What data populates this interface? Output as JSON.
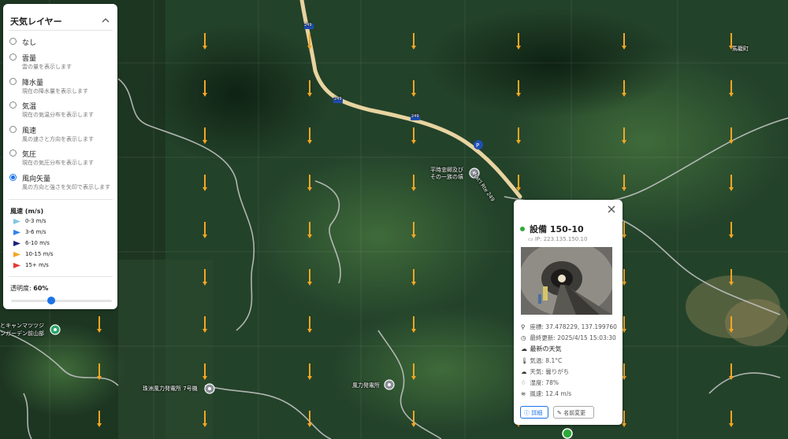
{
  "weather_panel": {
    "title": "天気レイヤー",
    "layers": [
      {
        "name": "なし",
        "desc": "",
        "checked": false
      },
      {
        "name": "雲量",
        "desc": "雲の量を表示します",
        "checked": false
      },
      {
        "name": "降水量",
        "desc": "現在の降水量を表示します",
        "checked": false
      },
      {
        "name": "気温",
        "desc": "現在の気温分布を表示します",
        "checked": false
      },
      {
        "name": "風速",
        "desc": "風の速さと方向を表示します",
        "checked": false
      },
      {
        "name": "気圧",
        "desc": "現在の気圧分布を表示します",
        "checked": false
      },
      {
        "name": "風向矢量",
        "desc": "風の方向と強さを矢印で表示します",
        "checked": true
      }
    ],
    "legend_title": "風速 (m/s)",
    "legend": [
      {
        "label": "0-3 m/s",
        "color": "#7ec8e3"
      },
      {
        "label": "3-6 m/s",
        "color": "#2f80ed"
      },
      {
        "label": "6-10 m/s",
        "color": "#1a237e"
      },
      {
        "label": "10-15 m/s",
        "color": "#f5a623"
      },
      {
        "label": "15+ m/s",
        "color": "#e53935"
      }
    ],
    "opacity_label": "透明度:",
    "opacity_value": "60%",
    "opacity_fraction": 0.6
  },
  "map_labels": {
    "town": "馬籠町",
    "road_number": "249",
    "route_label": "Nat'l Rte 249",
    "poi_grave": "平時忠卿及び\nその一族の墳",
    "poi_wind7": "珠洲風力発電所 7号機",
    "poi_wind": "風力発電所",
    "poi_garden": "とキャンマツツジ\nンガーデン前山部"
  },
  "popup": {
    "name": "設備 150-10",
    "ip": "IP: 223.135.150.10",
    "coords": "座標: 37.478229, 137.199760",
    "updated": "最終更新: 2025/4/15 15:03:30",
    "weather_heading": "最新の天気",
    "temperature": "気温: 8.1°C",
    "weather": "天気: 曇りがち",
    "humidity": "湿度: 78%",
    "wind": "風速: 12.4 m/s",
    "detail_button": "詳細",
    "rename_button": "名前変更",
    "status_color": "#2eaa3a"
  },
  "wind_arrow_color": "#f5a623"
}
